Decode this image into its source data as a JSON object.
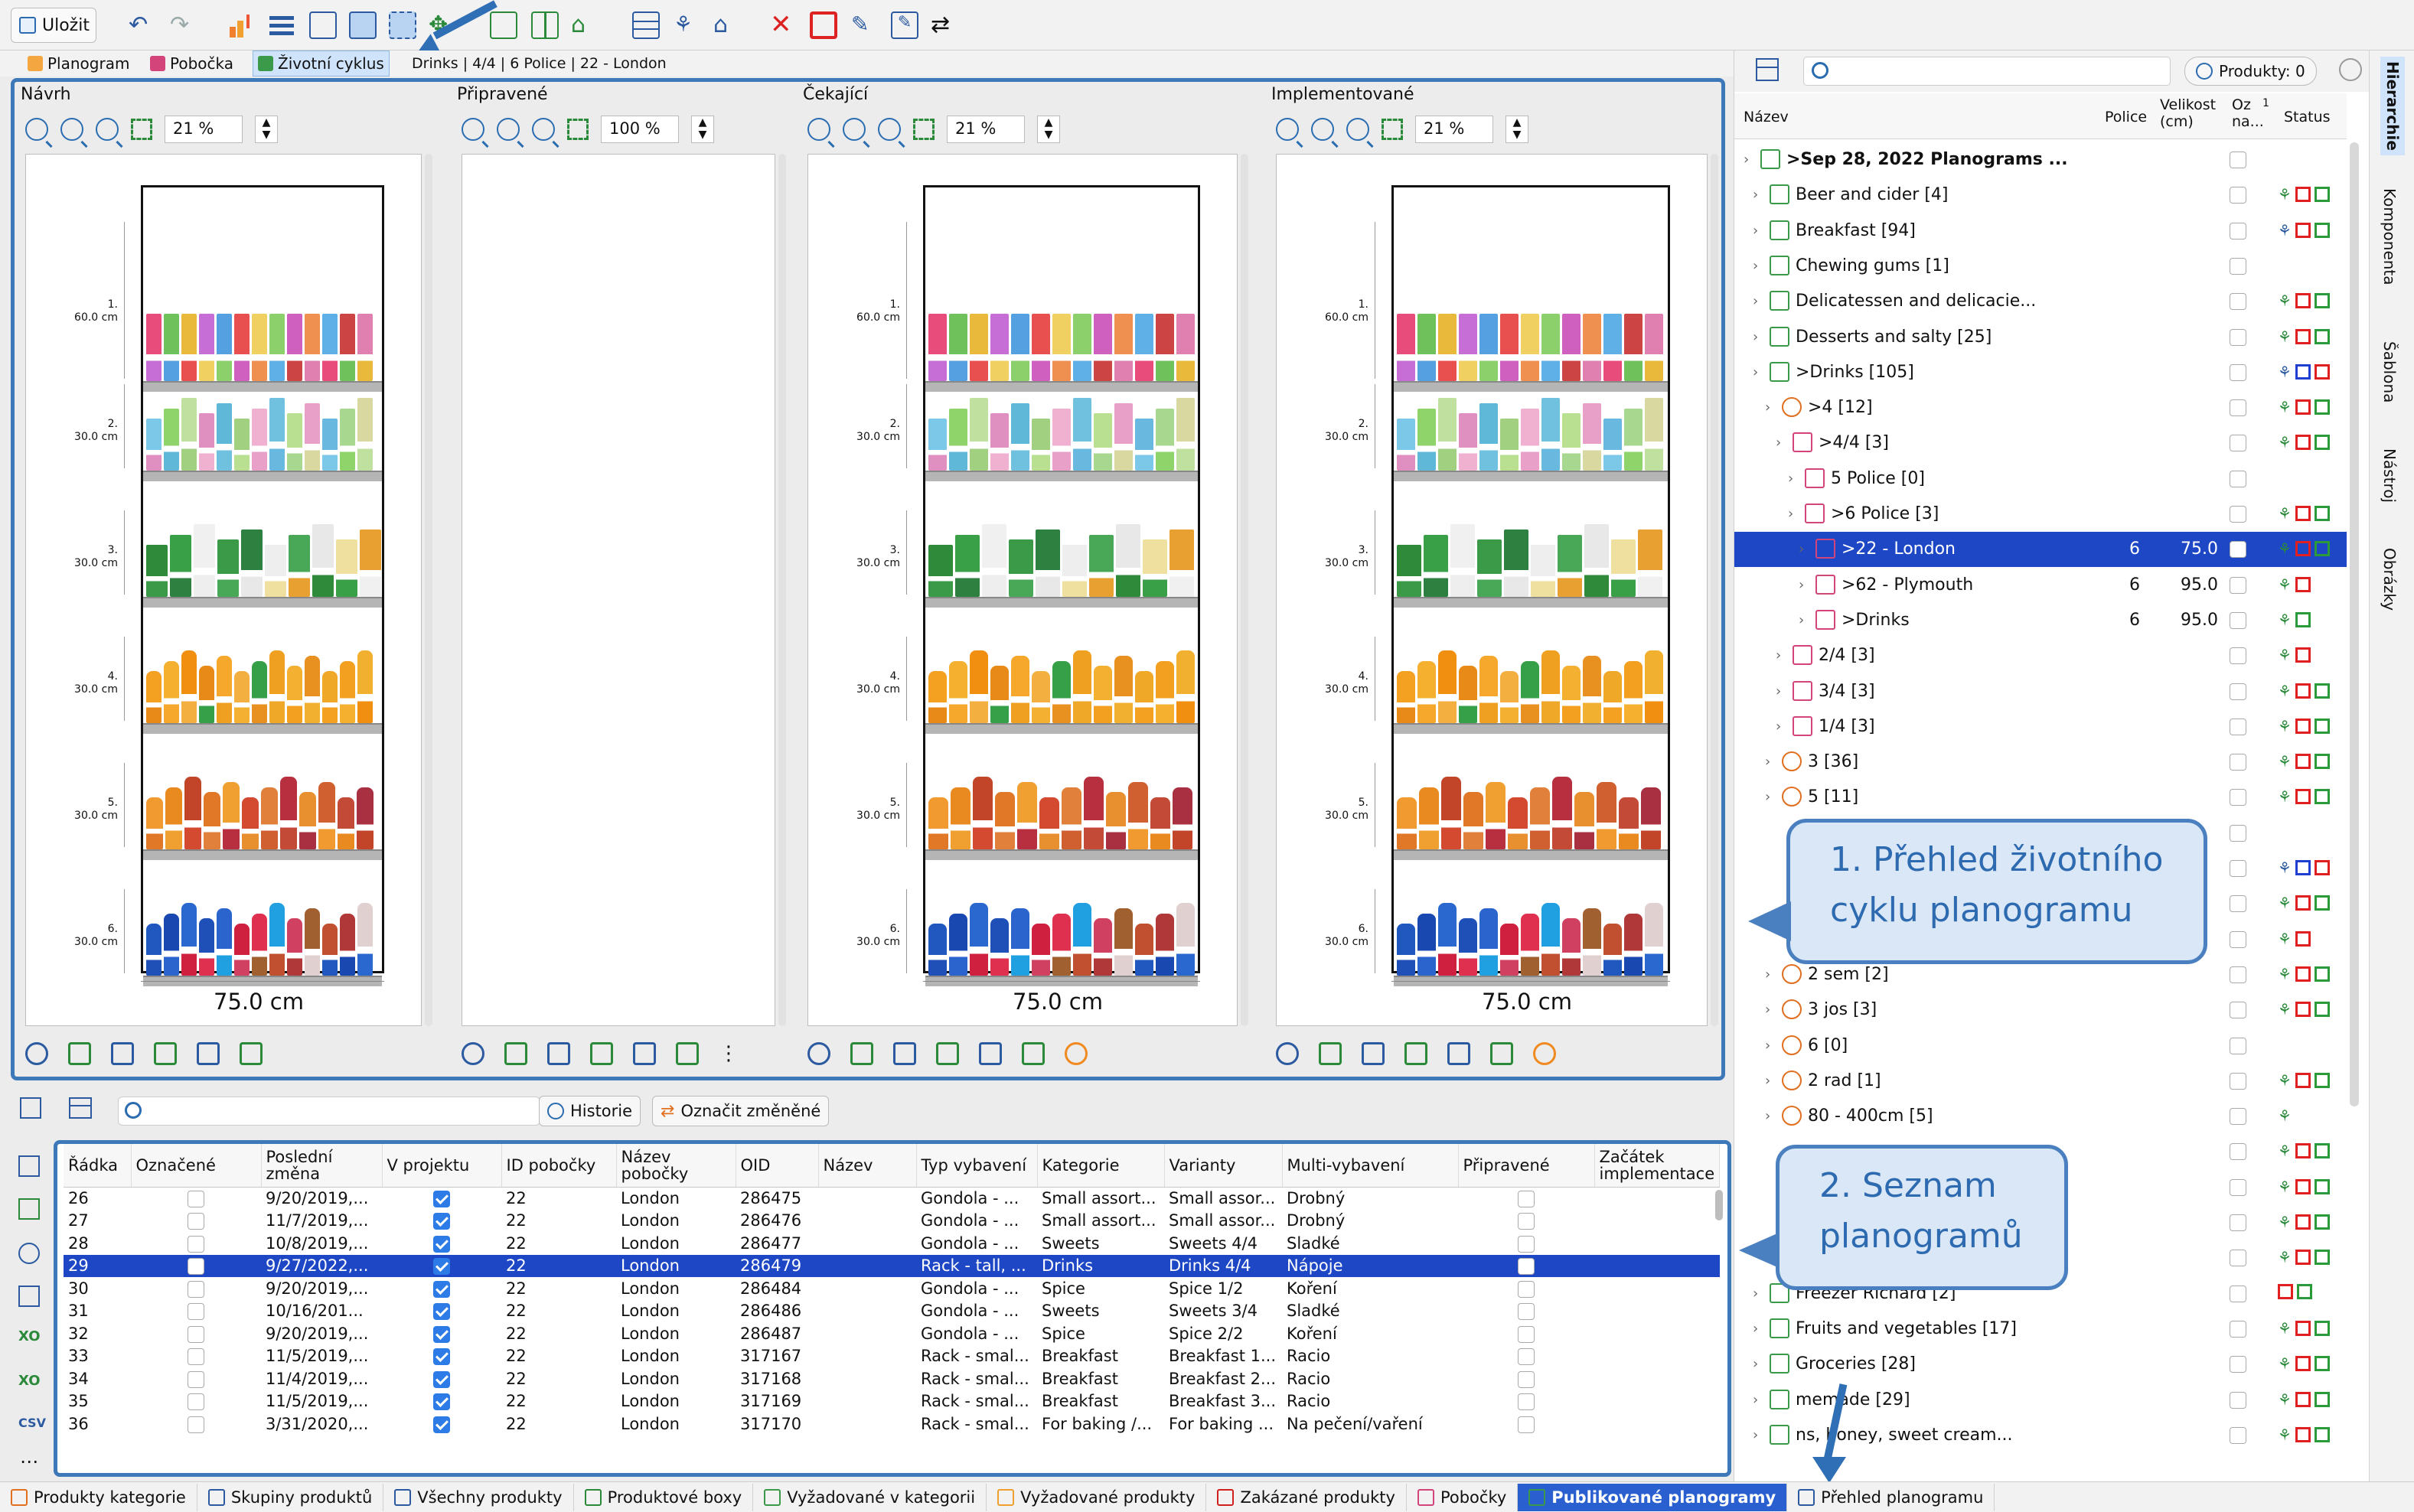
{
  "toolbar": {
    "save_label": "Uložit"
  },
  "tabs": [
    {
      "label": "Planogram",
      "active": false
    },
    {
      "label": "Pobočka",
      "active": false
    },
    {
      "label": "Životní cyklus",
      "active": true
    }
  ],
  "breadcrumb": "Drinks | 4/4 | 6 Police | 22 - London",
  "stages": [
    {
      "title": "Návrh",
      "zoom": "21 %",
      "has_planogram": true,
      "width_label": "75.0 cm"
    },
    {
      "title": "Připravené",
      "zoom": "100 %",
      "has_planogram": false,
      "width_label": ""
    },
    {
      "title": "Čekající",
      "zoom": "21 %",
      "has_planogram": true,
      "width_label": "75.0 cm"
    },
    {
      "title": "Implementované",
      "zoom": "21 %",
      "has_planogram": true,
      "width_label": "75.0 cm"
    }
  ],
  "shelf_labels": [
    {
      "num": "1.",
      "height": "60.0 cm"
    },
    {
      "num": "2.",
      "height": "30.0 cm"
    },
    {
      "num": "3.",
      "height": "30.0 cm"
    },
    {
      "num": "4.",
      "height": "30.0 cm"
    },
    {
      "num": "5.",
      "height": "30.0 cm"
    },
    {
      "num": "6.",
      "height": "30.0 cm"
    }
  ],
  "right_panel": {
    "filter_label": "Produkty: 0",
    "columns": {
      "name": "Název",
      "police": "Police",
      "size": "Velikost (cm)",
      "marked": "Oz na...",
      "sort_marker": "1",
      "status": "Status"
    },
    "rows": [
      {
        "label": ">Sep 28, 2022 Planograms ...",
        "level": 0,
        "police": "",
        "size": "",
        "bold": true,
        "status": [],
        "icon": "calendar-grid"
      },
      {
        "label": "Beer and cider [4]",
        "level": 1,
        "police": "",
        "size": "",
        "status": [
          "green-tree",
          "red",
          "green"
        ]
      },
      {
        "label": "Breakfast [94]",
        "level": 1,
        "police": "",
        "size": "",
        "status": [
          "blue-tree",
          "red",
          "green"
        ]
      },
      {
        "label": "Chewing gums [1]",
        "level": 1,
        "police": "",
        "size": "",
        "status": []
      },
      {
        "label": "Delicatessen and delicacie...",
        "level": 1,
        "police": "",
        "size": "",
        "status": [
          "green-tree",
          "red",
          "green"
        ]
      },
      {
        "label": "Desserts and salty [25]",
        "level": 1,
        "police": "",
        "size": "",
        "status": [
          "green-tree",
          "red",
          "green"
        ]
      },
      {
        "label": ">Drinks [105]",
        "level": 1,
        "police": "",
        "size": "",
        "status": [
          "blue-tree",
          "blue",
          "red"
        ]
      },
      {
        "label": ">4 [12]",
        "level": 2,
        "police": "",
        "size": "",
        "status": [
          "green-tree",
          "red",
          "green"
        ]
      },
      {
        "label": ">4/4 [3]",
        "level": 3,
        "police": "",
        "size": "",
        "status": [
          "green-tree",
          "red",
          "green"
        ]
      },
      {
        "label": "5 Police [0]",
        "level": 4,
        "police": "",
        "size": "",
        "status": []
      },
      {
        "label": ">6 Police [3]",
        "level": 4,
        "police": "",
        "size": "",
        "status": [
          "green-tree",
          "red",
          "green"
        ]
      },
      {
        "label": ">22 - London",
        "level": 5,
        "police": "6",
        "size": "75.0",
        "selected": true,
        "status": [
          "green-tree",
          "red",
          "green"
        ]
      },
      {
        "label": ">62 - Plymouth",
        "level": 5,
        "police": "6",
        "size": "95.0",
        "status": [
          "green-tree",
          "red"
        ]
      },
      {
        "label": ">Drinks",
        "level": 5,
        "police": "6",
        "size": "95.0",
        "status": [
          "green-tree",
          "green"
        ]
      },
      {
        "label": "2/4 [3]",
        "level": 3,
        "police": "",
        "size": "",
        "status": [
          "green-tree",
          "red"
        ]
      },
      {
        "label": "3/4 [3]",
        "level": 3,
        "police": "",
        "size": "",
        "status": [
          "green-tree",
          "red",
          "green"
        ]
      },
      {
        "label": "1/4 [3]",
        "level": 3,
        "police": "",
        "size": "",
        "status": [
          "green-tree",
          "red",
          "green"
        ]
      },
      {
        "label": "3 [36]",
        "level": 2,
        "police": "",
        "size": "",
        "status": [
          "green-tree",
          "red",
          "green"
        ]
      },
      {
        "label": "5 [11]",
        "level": 2,
        "police": "",
        "size": "",
        "status": [
          "green-tree",
          "red",
          "green"
        ]
      },
      {
        "label": "",
        "level": 2,
        "police": "",
        "size": "",
        "status": []
      },
      {
        "label": "",
        "level": 2,
        "police": "",
        "size": "",
        "status": [
          "blue-tree",
          "blue",
          "red"
        ]
      },
      {
        "label": "",
        "level": 2,
        "police": "",
        "size": "",
        "status": [
          "green-tree",
          "red",
          "green"
        ]
      },
      {
        "label": "",
        "level": 2,
        "police": "",
        "size": "",
        "status": [
          "green-tree",
          "red"
        ]
      },
      {
        "label": "2 sem [2]",
        "level": 2,
        "police": "",
        "size": "",
        "status": [
          "green-tree",
          "red",
          "green"
        ]
      },
      {
        "label": "3 jos [3]",
        "level": 2,
        "police": "",
        "size": "",
        "status": [
          "green-tree",
          "red",
          "green"
        ]
      },
      {
        "label": "6 [0]",
        "level": 2,
        "police": "",
        "size": "",
        "status": []
      },
      {
        "label": "2 rad [1]",
        "level": 2,
        "police": "",
        "size": "",
        "status": [
          "green-tree",
          "red",
          "green"
        ]
      },
      {
        "label": "80 - 400cm [5]",
        "level": 2,
        "police": "",
        "size": "",
        "status": [
          "green-tree"
        ]
      },
      {
        "label": "",
        "level": 2,
        "police": "",
        "size": "",
        "status": [
          "green-tree",
          "red",
          "green"
        ]
      },
      {
        "label": "",
        "level": 2,
        "police": "",
        "size": "",
        "status": [
          "green-tree",
          "red",
          "green"
        ]
      },
      {
        "label": "",
        "level": 2,
        "police": "",
        "size": "",
        "status": [
          "green-tree",
          "red",
          "green"
        ]
      },
      {
        "label": "",
        "level": 2,
        "police": "",
        "size": "",
        "status": [
          "green-tree",
          "red",
          "green"
        ]
      },
      {
        "label": "Freezer Richard [2]",
        "level": 1,
        "police": "",
        "size": "",
        "status": [
          "red",
          "green"
        ]
      },
      {
        "label": "Fruits and vegetables [17]",
        "level": 1,
        "police": "",
        "size": "",
        "status": [
          "green-tree",
          "red",
          "green"
        ]
      },
      {
        "label": "Groceries [28]",
        "level": 1,
        "police": "",
        "size": "",
        "status": [
          "green-tree",
          "red",
          "green"
        ]
      },
      {
        "label": "memade [29]",
        "level": 1,
        "police": "",
        "size": "",
        "status": [
          "green-tree",
          "red",
          "green"
        ]
      },
      {
        "label": "ns, honey, sweet cream...",
        "level": 1,
        "police": "",
        "size": "",
        "status": [
          "green-tree",
          "red",
          "green"
        ]
      }
    ]
  },
  "side_tabs": [
    "Hierarchie",
    "Komponenta",
    "Šablona",
    "Nástroj",
    "Obrázky"
  ],
  "callouts": [
    {
      "line1": "1. Přehled životního",
      "line2": "cyklu planogramu"
    },
    {
      "line1": "2. Seznam",
      "line2": "planogramů"
    }
  ],
  "bottom": {
    "history_label": "Historie",
    "mark_changed_label": "Označit změněné",
    "columns": [
      "Řádka",
      "Označené",
      "Poslední změna",
      "V projektu",
      "ID pobočky",
      "Název pobočky",
      "OID",
      "Název",
      "Typ vybavení",
      "Kategorie",
      "Varianty",
      "Multi-vybavení",
      "Připravené",
      "Začátek implementace"
    ],
    "rows": [
      {
        "row": "26",
        "date": "9/20/2019,...",
        "id": "22",
        "branch": "London",
        "oid": "286475",
        "name": "",
        "type": "Gondola - ...",
        "cat": "Small assort...",
        "var": "Small assor...",
        "multi": "Drobný"
      },
      {
        "row": "27",
        "date": "11/7/2019,...",
        "id": "22",
        "branch": "London",
        "oid": "286476",
        "name": "",
        "type": "Gondola - ...",
        "cat": "Small assort...",
        "var": "Small assor...",
        "multi": "Drobný"
      },
      {
        "row": "28",
        "date": "10/8/2019,...",
        "id": "22",
        "branch": "London",
        "oid": "286477",
        "name": "",
        "type": "Gondola - ...",
        "cat": "Sweets",
        "var": "Sweets 4/4",
        "multi": "Sladké"
      },
      {
        "row": "29",
        "date": "9/27/2022,...",
        "id": "22",
        "branch": "London",
        "oid": "286479",
        "name": "",
        "type": "Rack - tall, ...",
        "cat": "Drinks",
        "var": "Drinks 4/4",
        "multi": "Nápoje",
        "selected": true
      },
      {
        "row": "30",
        "date": "9/20/2019,...",
        "id": "22",
        "branch": "London",
        "oid": "286484",
        "name": "",
        "type": "Gondola - ...",
        "cat": "Spice",
        "var": "Spice 1/2",
        "multi": "Koření"
      },
      {
        "row": "31",
        "date": "10/16/201...",
        "id": "22",
        "branch": "London",
        "oid": "286486",
        "name": "",
        "type": "Gondola - ...",
        "cat": "Sweets",
        "var": "Sweets 3/4",
        "multi": "Sladké"
      },
      {
        "row": "32",
        "date": "9/20/2019,...",
        "id": "22",
        "branch": "London",
        "oid": "286487",
        "name": "",
        "type": "Gondola - ...",
        "cat": "Spice",
        "var": "Spice 2/2",
        "multi": "Koření"
      },
      {
        "row": "33",
        "date": "11/5/2019,...",
        "id": "22",
        "branch": "London",
        "oid": "317167",
        "name": "",
        "type": "Rack - smal...",
        "cat": "Breakfast",
        "var": "Breakfast 1...",
        "multi": "Racio"
      },
      {
        "row": "34",
        "date": "11/4/2019,...",
        "id": "22",
        "branch": "London",
        "oid": "317168",
        "name": "",
        "type": "Rack - smal...",
        "cat": "Breakfast",
        "var": "Breakfast 2...",
        "multi": "Racio"
      },
      {
        "row": "35",
        "date": "11/5/2019,...",
        "id": "22",
        "branch": "London",
        "oid": "317169",
        "name": "",
        "type": "Rack - smal...",
        "cat": "Breakfast",
        "var": "Breakfast 3...",
        "multi": "Racio"
      },
      {
        "row": "36",
        "date": "3/31/2020,...",
        "id": "22",
        "branch": "London",
        "oid": "317170",
        "name": "",
        "type": "Rack - smal...",
        "cat": "For baking /...",
        "var": "For baking ...",
        "multi": "Na pečení/vaření"
      }
    ]
  },
  "status_tabs": [
    {
      "label": "Produkty kategorie",
      "active": false
    },
    {
      "label": "Skupiny produktů",
      "active": false
    },
    {
      "label": "Všechny produkty",
      "active": false
    },
    {
      "label": "Produktové boxy",
      "active": false
    },
    {
      "label": "Vyžadované v kategorii",
      "active": false
    },
    {
      "label": "Vyžadované produkty",
      "active": false
    },
    {
      "label": "Zakázané produkty",
      "active": false
    },
    {
      "label": "Pobočky",
      "active": false
    },
    {
      "label": "Publikované planogramy",
      "active": true
    },
    {
      "label": "Přehled planogramu",
      "active": false
    }
  ],
  "colors": {
    "accent": "#3d78b8",
    "selection": "#1e47c6",
    "callout_fill": "#d9e7f7",
    "callout_text": "#2e6ab0"
  }
}
